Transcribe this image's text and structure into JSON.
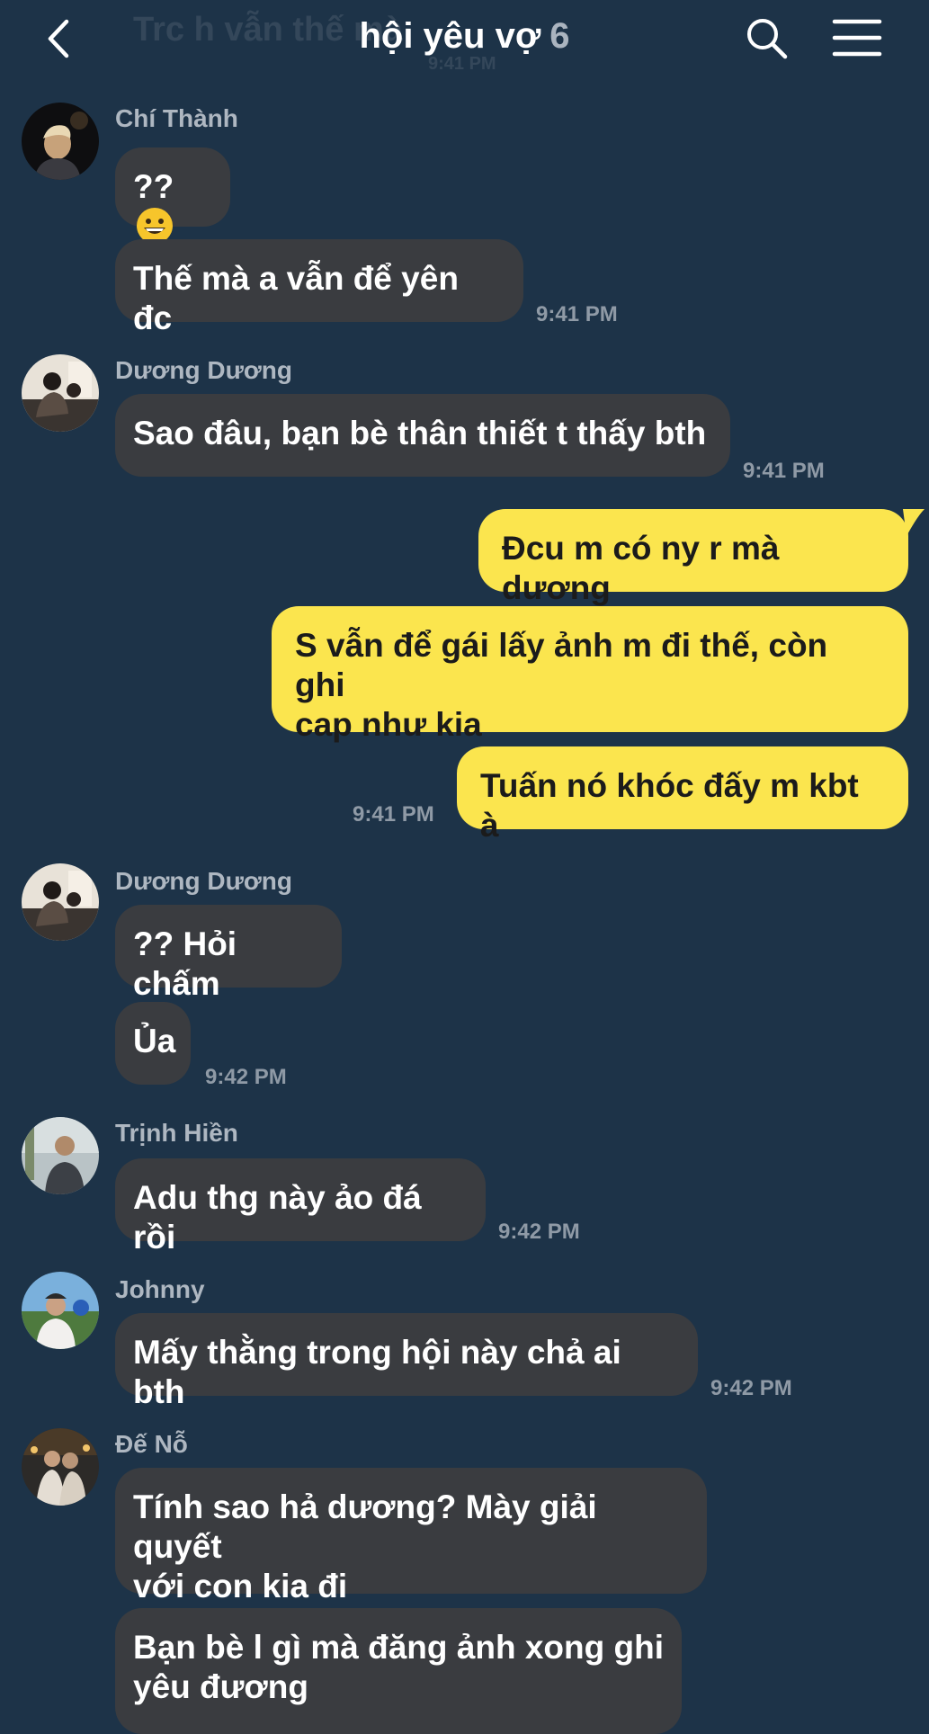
{
  "header": {
    "back_icon": "chevron-left-icon",
    "title": "hội yêu vợ",
    "member_count": "6",
    "search_icon": "search-icon",
    "menu_icon": "hamburger-menu-icon",
    "ghost_text": "Trc h vẫn thế mà",
    "ghost_time": "9:41 PM"
  },
  "colors": {
    "background": "#1d3348",
    "incoming_bubble": "#3a3c40",
    "outgoing_bubble": "#fbe54e",
    "timestamp": "#8f9aa6",
    "sender_name": "#aeb7c1"
  },
  "messages": [
    {
      "sender": "Chí Thành",
      "text": "??",
      "emoji": "grinning-face-emoji"
    },
    {
      "text": "Thế mà a vẫn để yên đc",
      "time": "9:41 PM"
    },
    {
      "sender": "Dương Dương",
      "text": "Sao đâu, bạn bè thân thiết t thấy bth",
      "time": "9:41 PM"
    },
    {
      "outgoing": true,
      "text": "Đcu m có ny r mà dương"
    },
    {
      "outgoing": true,
      "lines": [
        "S vẫn để gái lấy ảnh m đi thế, còn ghi",
        "cap như kia"
      ]
    },
    {
      "outgoing": true,
      "text": "Tuấn nó khóc đấy m kbt à",
      "time": "9:41 PM"
    },
    {
      "sender": "Dương Dương",
      "text": "?? Hỏi chấm"
    },
    {
      "text": "Ủa",
      "time": "9:42 PM"
    },
    {
      "sender": "Trịnh Hiền",
      "text": "Adu thg này ảo đá rồi",
      "time": "9:42 PM"
    },
    {
      "sender": "Johnny",
      "text": "Mấy thằng trong hội này chả ai bth",
      "time": "9:42 PM"
    },
    {
      "sender": "Đế Nỗ",
      "lines": [
        "Tính sao hả dương? Mày giải quyết",
        "với con kia đi"
      ]
    },
    {
      "lines": [
        "Bạn bè l gì mà đăng ảnh xong ghi",
        "yêu đương"
      ]
    }
  ]
}
